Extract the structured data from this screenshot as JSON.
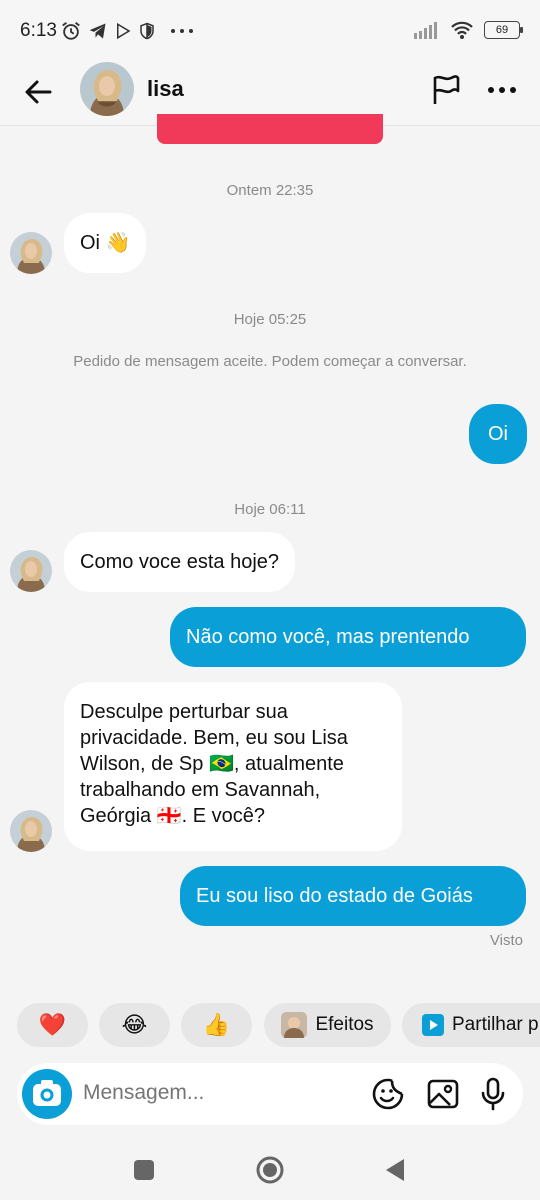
{
  "status_bar": {
    "time": "6:13",
    "battery": "69",
    "icons": [
      "alarm-icon",
      "telegram-icon",
      "play-store-icon",
      "shield-icon",
      "more-dots-icon",
      "signal-icon",
      "wifi-icon",
      "battery-icon"
    ]
  },
  "header": {
    "contact_name": "lisa",
    "icons": [
      "back-arrow-icon",
      "avatar",
      "flag-icon",
      "more-icon"
    ]
  },
  "timestamps": [
    "Ontem 22:35",
    "Hoje 05:25",
    "Hoje 06:11"
  ],
  "system_note": "Pedido de mensagem aceite. Podem começar a conversar.",
  "messages": [
    {
      "from": "lisa",
      "text": "Oi 👋"
    },
    {
      "from": "me",
      "text": "Oi"
    },
    {
      "from": "lisa",
      "text": "Como voce esta hoje?"
    },
    {
      "from": "me",
      "text": "Não como você, mas prentendo"
    },
    {
      "from": "lisa",
      "text": "Desculpe perturbar sua privacidade. Bem, eu sou Lisa Wilson, de Sp 🇧🇷, atualmente trabalhando em Savannah, Geórgia 🇬🇪. E você?"
    },
    {
      "from": "me",
      "text": "Eu sou liso do estado de Goiás"
    }
  ],
  "seen_label": "Visto",
  "quick_actions": [
    {
      "label": "❤️"
    },
    {
      "label": "😂"
    },
    {
      "label": "👍"
    },
    {
      "label": "Efeitos"
    },
    {
      "label": "Partilhar p"
    }
  ],
  "composer": {
    "placeholder": "Mensagem...",
    "icons": [
      "camera-icon",
      "sticker-icon",
      "gallery-icon",
      "microphone-icon"
    ]
  },
  "nav_bar": {
    "icons": [
      "recents-icon",
      "home-icon",
      "back-icon"
    ]
  },
  "colors": {
    "accent": "#0a9fd6",
    "background": "#f4f4f4",
    "incoming_bubble": "#ffffff",
    "muted_text": "#8a8a8a",
    "cut_button": "#f13a5a"
  }
}
